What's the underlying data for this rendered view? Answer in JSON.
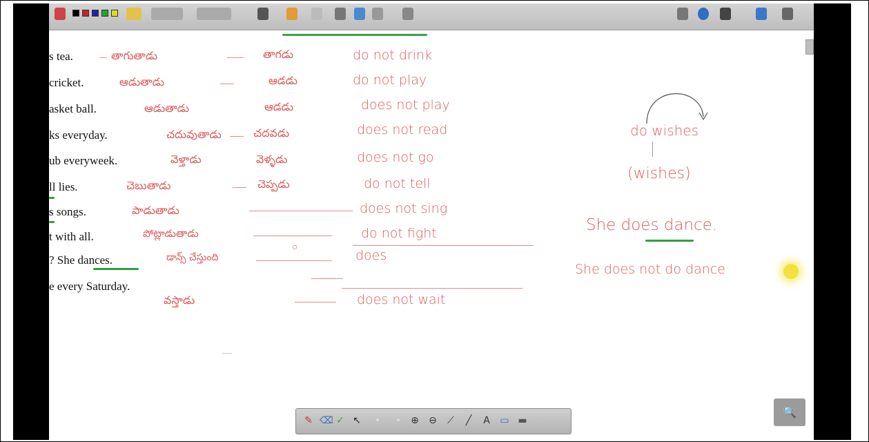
{
  "sentences": [
    "s tea.",
    "cricket.",
    "asket ball.",
    "ks everyday.",
    "ub everyweek.",
    "ll lies.",
    "s songs.",
    "t with all.",
    "? She dances.",
    "e every Saturday."
  ],
  "telugu_col1": [
    "తాగుతాడు",
    "ఆడుతాడు",
    "ఆడుతాడు",
    "చదువుతాడు",
    "వెళ్తాడు",
    "చెబుతాడు",
    "పాడుతాడు",
    "పోట్లాడుతాడు",
    "డాన్స్ చేస్తుంది",
    "వస్తాడు"
  ],
  "telugu_col2": [
    "తాగడు",
    "ఆడడు",
    "ఆడడు",
    "చదవడు",
    "వెళ్ళడు",
    "చెప్పడు",
    "",
    "",
    "",
    ""
  ],
  "english_col": [
    "do not drink",
    "do not play",
    "does not play",
    "does not read",
    "does not go",
    "do not tell",
    "does not sing",
    "do not fight",
    "does",
    "does not wait"
  ],
  "right_notes": {
    "top": "do wishes",
    "paren": "(wishes)",
    "example": "She does dance.",
    "example2": "She does not do dance"
  },
  "zoom_label": "🔍"
}
